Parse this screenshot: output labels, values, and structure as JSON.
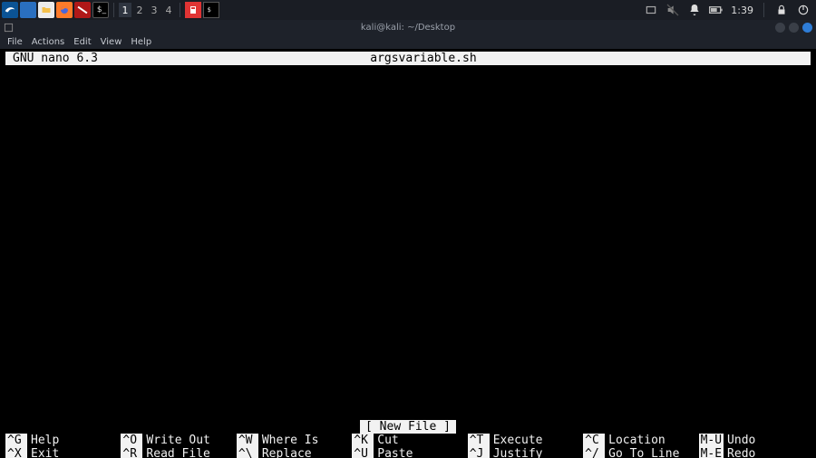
{
  "taskbar": {
    "workspaces": [
      "1",
      "2",
      "3",
      "4"
    ],
    "active_workspace": 0,
    "clock": "1:39"
  },
  "window": {
    "title": "kali@kali: ~/Desktop"
  },
  "menubar": {
    "items": [
      "File",
      "Actions",
      "Edit",
      "View",
      "Help"
    ]
  },
  "nano": {
    "app": "GNU nano 6.3",
    "filename": "argsvariable.sh",
    "status": "[ New File ]",
    "shortcuts_row1": [
      {
        "key": "^G",
        "label": "Help"
      },
      {
        "key": "^O",
        "label": "Write Out"
      },
      {
        "key": "^W",
        "label": "Where Is"
      },
      {
        "key": "^K",
        "label": "Cut"
      },
      {
        "key": "^T",
        "label": "Execute"
      },
      {
        "key": "^C",
        "label": "Location"
      }
    ],
    "shortcuts_row2": [
      {
        "key": "^X",
        "label": "Exit"
      },
      {
        "key": "^R",
        "label": "Read File"
      },
      {
        "key": "^\\",
        "label": "Replace"
      },
      {
        "key": "^U",
        "label": "Paste"
      },
      {
        "key": "^J",
        "label": "Justify"
      },
      {
        "key": "^/",
        "label": "Go To Line"
      }
    ],
    "shortcuts_extra": [
      {
        "key": "M-U",
        "label": "Undo"
      },
      {
        "key": "M-E",
        "label": "Redo"
      }
    ]
  }
}
